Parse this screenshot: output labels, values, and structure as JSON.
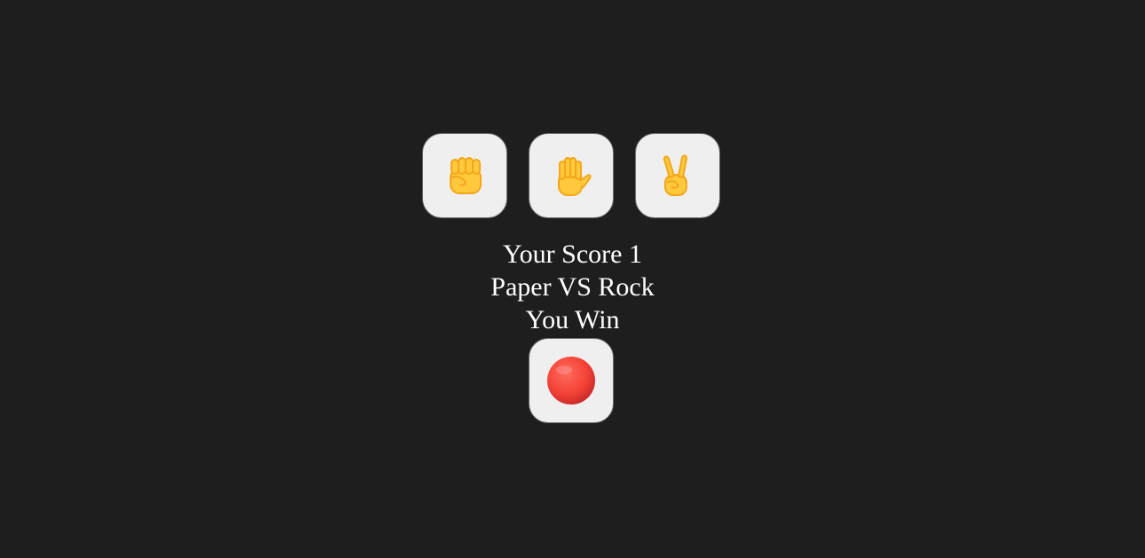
{
  "choices": [
    {
      "label": "Rock",
      "icon": "rock-fist-icon"
    },
    {
      "label": "Paper",
      "icon": "paper-hand-icon"
    },
    {
      "label": "Scissors",
      "icon": "scissors-victory-hand-icon"
    }
  ],
  "result": {
    "score_text": "Your Score 1",
    "matchup_text": "Paper VS Rock",
    "outcome_text": "You Win"
  },
  "reset": {
    "icon": "red-circle-icon"
  },
  "colors": {
    "background": "#1e1e1e",
    "button_bg": "#efefef",
    "button_border": "#6f6f6f",
    "text": "#ffffff",
    "emoji_yellow": "#ffc83d",
    "emoji_shadow": "#f3a719",
    "red": "#f44336"
  }
}
